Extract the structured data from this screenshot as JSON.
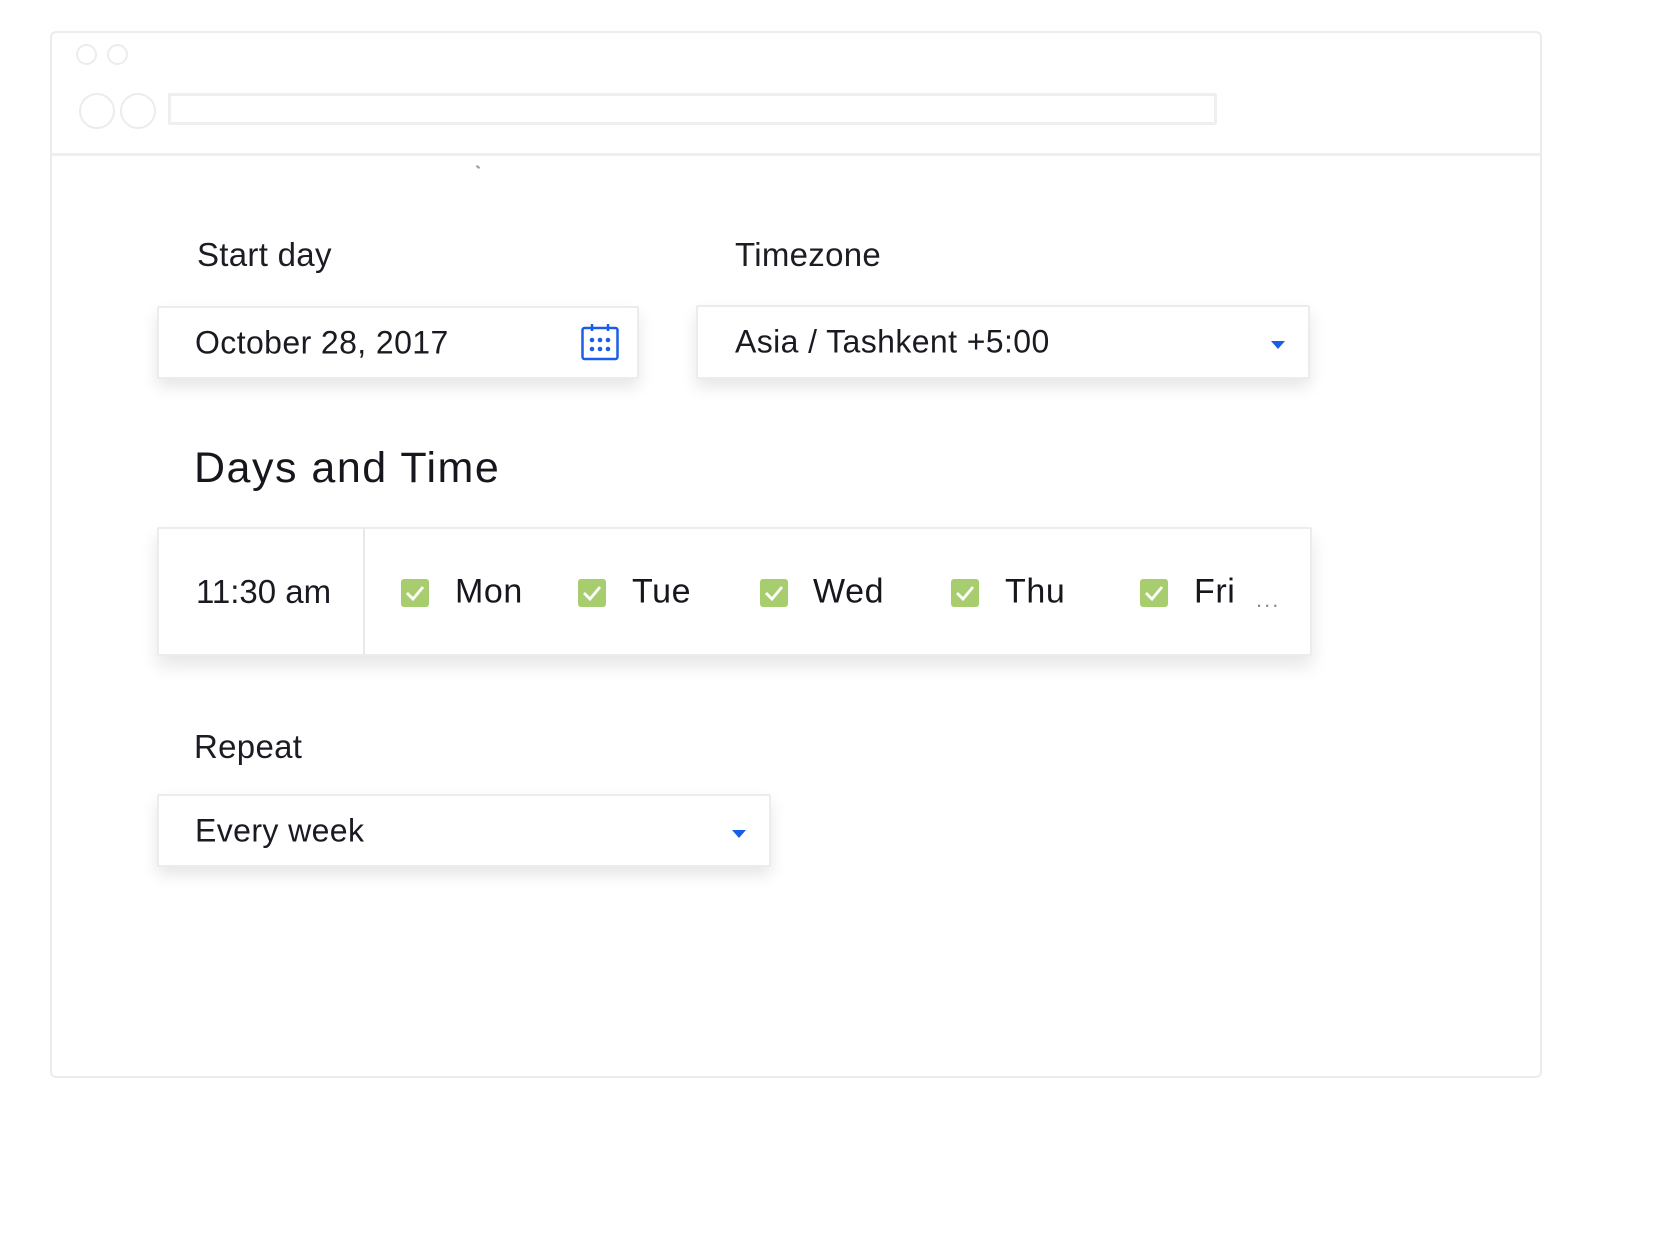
{
  "browser": {
    "address_bar_value": ""
  },
  "form": {
    "start_day": {
      "label": "Start day",
      "value": "October 28, 2017",
      "icon": "calendar-icon"
    },
    "timezone": {
      "label": "Timezone",
      "selected": "Asia / Tashkent +5:00",
      "icon": "caret-down-icon"
    },
    "days_and_time": {
      "heading": "Days and Time",
      "time": "11:30 am",
      "days": [
        {
          "label": "Mon",
          "checked": true
        },
        {
          "label": "Tue",
          "checked": true
        },
        {
          "label": "Wed",
          "checked": true
        },
        {
          "label": "Thu",
          "checked": true
        },
        {
          "label": "Fri",
          "checked": true
        }
      ],
      "more_indicator": "..."
    },
    "repeat": {
      "label": "Repeat",
      "selected": "Every week",
      "icon": "caret-down-icon"
    }
  },
  "colors": {
    "accent_blue": "#1a5ee8",
    "checkbox_green": "#a8cd6e",
    "border_gray": "#ececec",
    "text_dark": "#16161d"
  }
}
